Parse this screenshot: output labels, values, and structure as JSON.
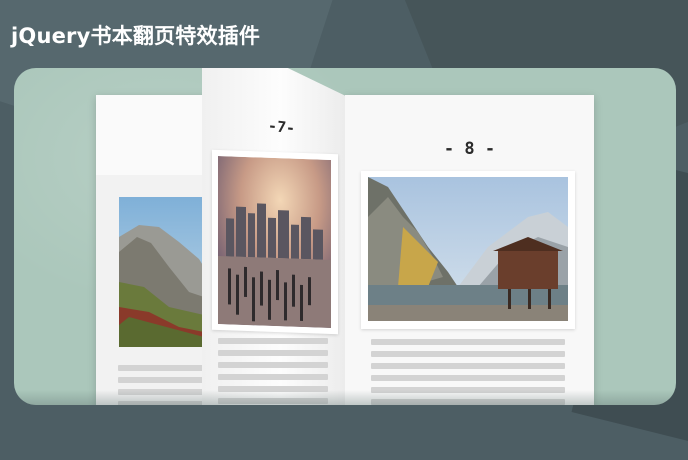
{
  "header": {
    "title": "jQuery书本翻页特效插件"
  },
  "book": {
    "left_page": {
      "page_number_visible": "-",
      "image": "mountain-valley-photo"
    },
    "flipping_page": {
      "page_number": "-7-",
      "image": "city-skyline-pier-photo"
    },
    "right_page": {
      "page_number": "- 8 -",
      "image": "lake-boathouse-photo"
    }
  },
  "colors": {
    "background": "#4d5e64",
    "stage": "#abc7bb",
    "page": "#f6f6f6",
    "text_lines": "#d3d3d3"
  }
}
